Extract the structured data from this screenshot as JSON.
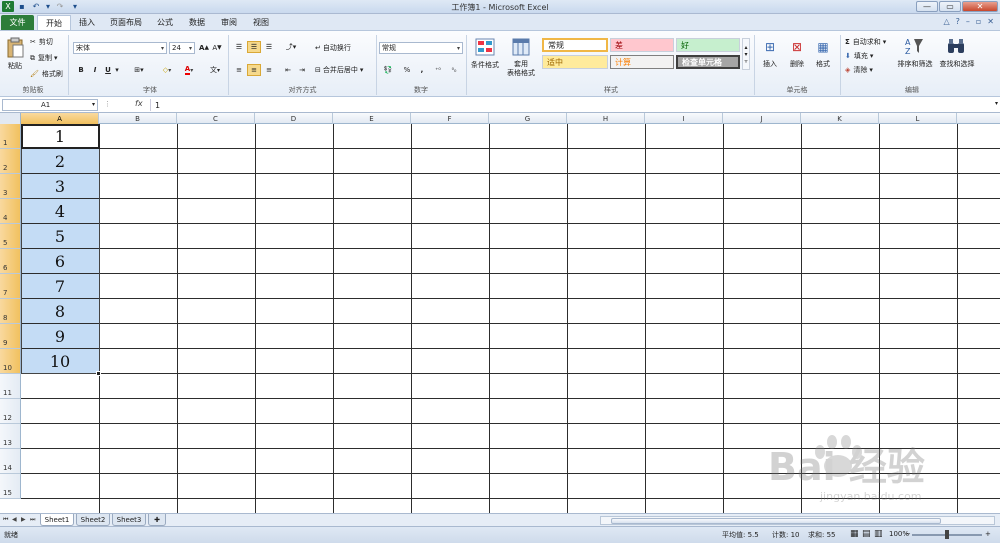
{
  "window": {
    "title": "工作簿1 - Microsoft Excel"
  },
  "tabs": [
    "文件",
    "开始",
    "插入",
    "页面布局",
    "公式",
    "数据",
    "审阅",
    "视图"
  ],
  "clipboard": {
    "paste": "粘贴",
    "cut": "剪切",
    "copy": "复制",
    "format_painter": "格式刷",
    "group": "剪贴板"
  },
  "font": {
    "name": "宋体",
    "size": "24",
    "bold": "B",
    "italic": "I",
    "underline": "U",
    "group": "字体",
    "font_color": "A",
    "wen": "文"
  },
  "alignment": {
    "wrap": "自动换行",
    "merge": "合并后居中",
    "group": "对齐方式"
  },
  "number": {
    "format": "常规",
    "percent": "%",
    "comma": ",",
    "group": "数字"
  },
  "styles": {
    "conditional": "条件格式",
    "table": "套用\n表格格式",
    "normal": "常规",
    "bad": "差",
    "good": "好",
    "neutral": "适中",
    "calc": "计算",
    "check": "检查单元格",
    "group": "样式"
  },
  "cells": {
    "insert": "插入",
    "delete": "删除",
    "format": "格式",
    "group": "单元格"
  },
  "editing": {
    "autosum": "自动求和",
    "fill": "填充",
    "clear": "清除",
    "sort": "排序和筛选",
    "find": "查找和选择",
    "group": "编辑"
  },
  "namebox": "A1",
  "fx": "fx",
  "formula": "1",
  "columns": [
    "A",
    "B",
    "C",
    "D",
    "E",
    "F",
    "G",
    "H",
    "I",
    "J",
    "K",
    "L"
  ],
  "rows": [
    "1",
    "2",
    "3",
    "4",
    "5",
    "6",
    "7",
    "8",
    "9",
    "10",
    "11",
    "12",
    "13",
    "14",
    "15"
  ],
  "values": [
    "1",
    "2",
    "3",
    "4",
    "5",
    "6",
    "7",
    "8",
    "9",
    "10"
  ],
  "sheets": [
    "Sheet1",
    "Sheet2",
    "Sheet3"
  ],
  "status": {
    "ready": "就绪",
    "average": "平均值: 5.5",
    "count": "计数: 10",
    "sum": "求和: 55",
    "zoom": "100%"
  },
  "watermark": {
    "text": "Bai 经验",
    "url": "jingyan.baidu.com"
  }
}
